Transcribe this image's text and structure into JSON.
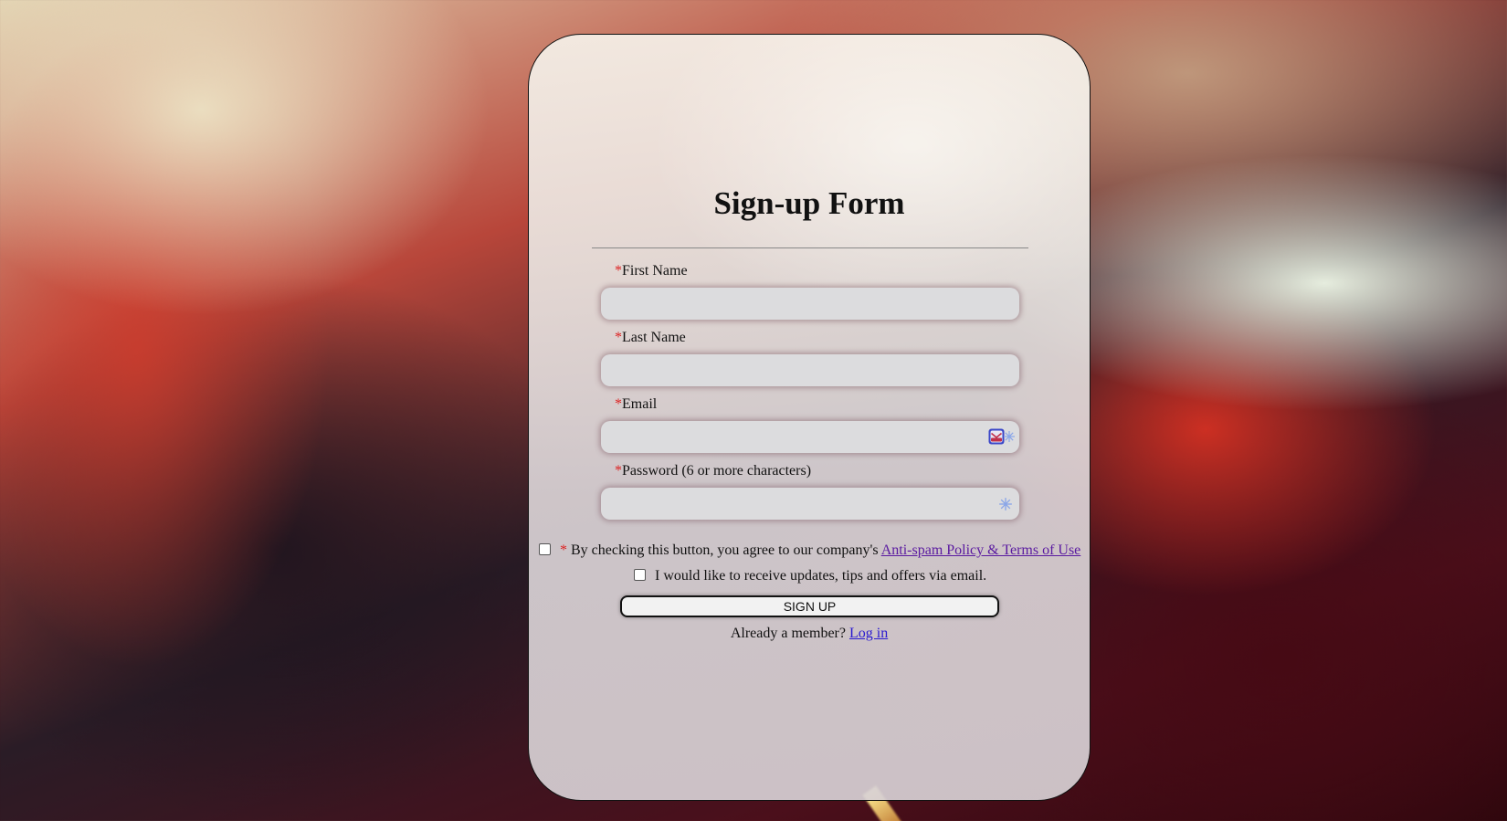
{
  "form": {
    "title": "Sign-up Form",
    "required_marker": "*",
    "fields": [
      {
        "label": "First Name",
        "value": "",
        "placeholder": ""
      },
      {
        "label": "Last Name",
        "value": "",
        "placeholder": ""
      },
      {
        "label": "Email",
        "value": "",
        "placeholder": ""
      },
      {
        "label": "Password (6 or more characters)",
        "value": "",
        "placeholder": ""
      }
    ],
    "terms": {
      "prefix": "* By checking this button, you agree to our company's ",
      "link_text": "Anti-spam Policy & Terms of Use",
      "checked": false
    },
    "updates": {
      "text": "I would like to receive updates, tips and offers via email.",
      "checked": false
    },
    "submit_label": "SIGN UP",
    "already_member_text": "Already a member? ",
    "login_link": "Log in"
  },
  "icons": {
    "email_field": [
      "email-extension-icon",
      "sparkle-icon"
    ],
    "password_field": [
      "sparkle-icon"
    ]
  },
  "colors": {
    "required": "#dd2222",
    "link_visited": "#5a1aa0",
    "link": "#2a1ad0",
    "field_bg": "#dcdcde"
  }
}
